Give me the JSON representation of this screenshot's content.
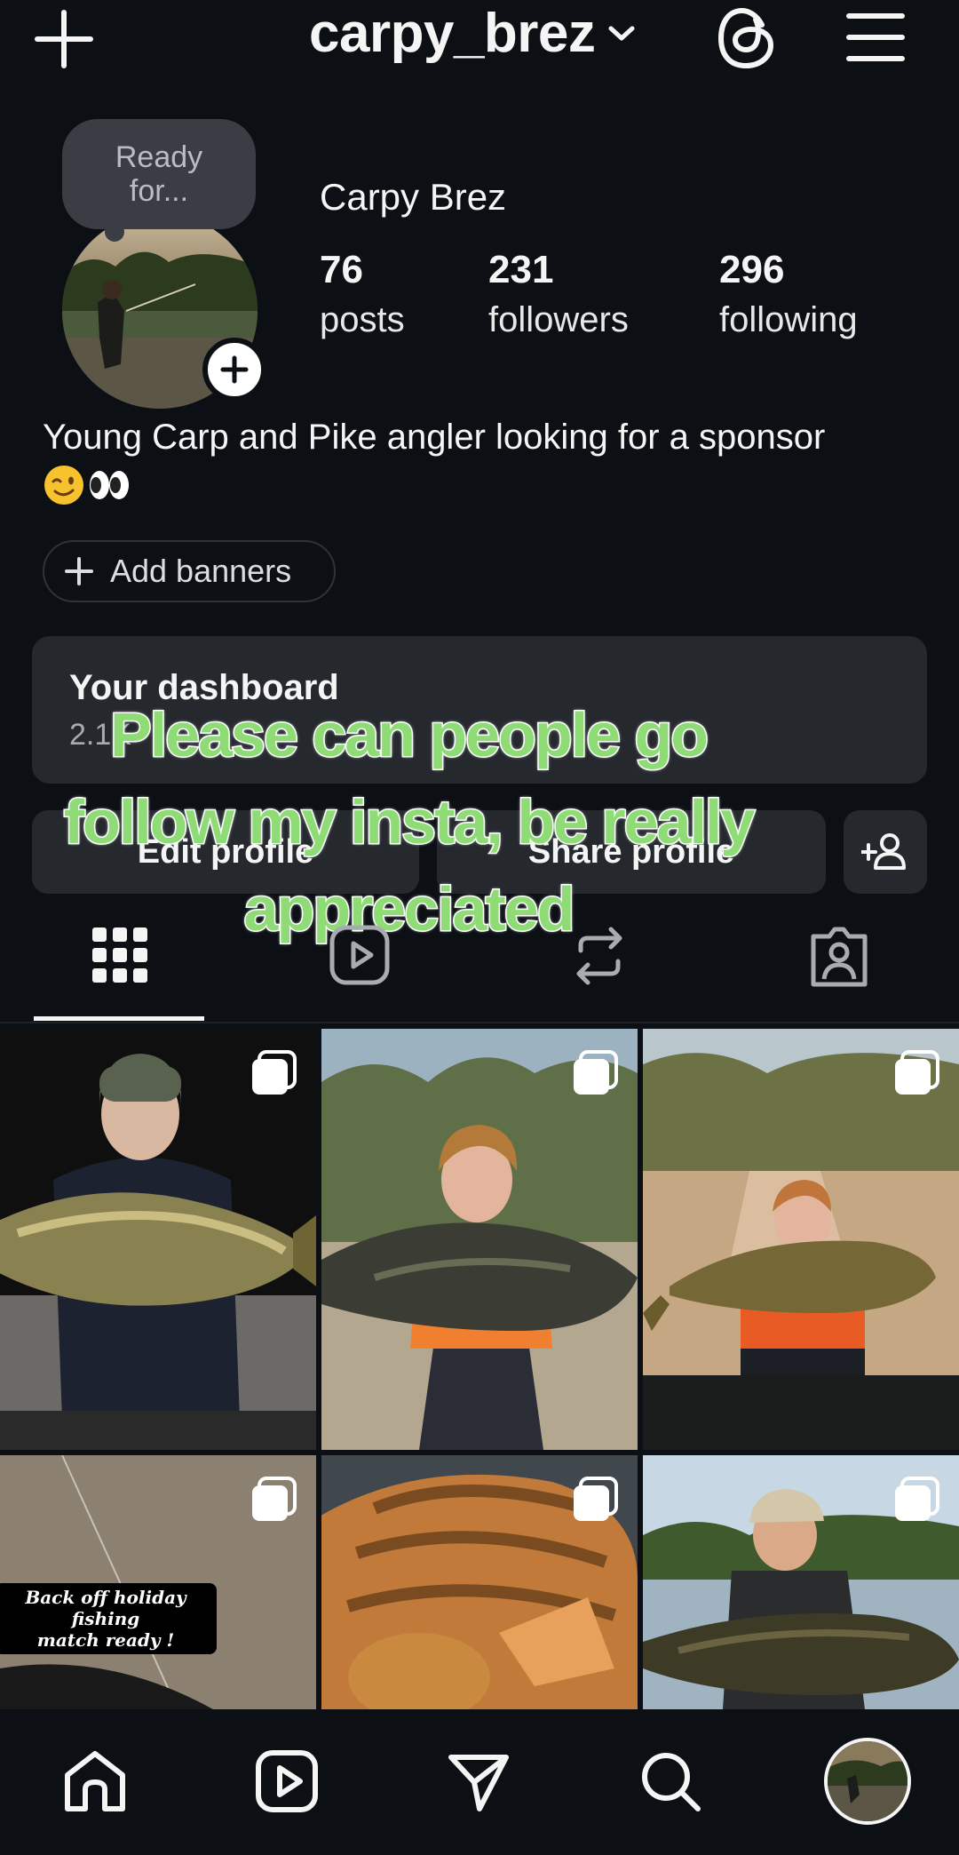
{
  "header": {
    "username": "carpy_brez",
    "icons": [
      "plus-icon",
      "chevron-down-icon",
      "threads-icon",
      "menu-icon"
    ]
  },
  "profile": {
    "note": [
      "Ready",
      "for..."
    ],
    "display_name": "Carpy Brez",
    "stats": [
      {
        "value": "76",
        "label": "posts"
      },
      {
        "value": "231",
        "label": "followers"
      },
      {
        "value": "296",
        "label": "following"
      }
    ],
    "bio": "Young Carp and Pike angler looking for a sponsor",
    "bio_emojis": [
      "wink-emoji",
      "eyes-emoji"
    ],
    "add_banners_label": "Add banners"
  },
  "dashboard": {
    "title": "Your dashboard",
    "subtitle": "2.1K"
  },
  "actions": {
    "edit_profile": "Edit profile",
    "share_profile": "Share profile"
  },
  "overlay_caption": [
    "Please can people go",
    "follow my insta, be really",
    "appreciated"
  ],
  "tabs": [
    "grid-icon",
    "reels-icon",
    "reposts-icon",
    "tagged-icon"
  ],
  "posts": [
    {
      "type": "photo",
      "multi": true
    },
    {
      "type": "photo",
      "multi": true
    },
    {
      "type": "photo",
      "multi": true
    },
    {
      "type": "photo",
      "multi": true,
      "text": [
        "Back off holiday fishing",
        "match ready !"
      ]
    },
    {
      "type": "art",
      "multi": true
    },
    {
      "type": "photo",
      "multi": true
    }
  ],
  "bottom_nav": [
    "home-icon",
    "reels-icon",
    "messages-icon",
    "search-icon",
    "profile-avatar"
  ],
  "colors": {
    "background": "#0c1014",
    "card": "#25292e",
    "caption_fill": "#8fdc77"
  }
}
